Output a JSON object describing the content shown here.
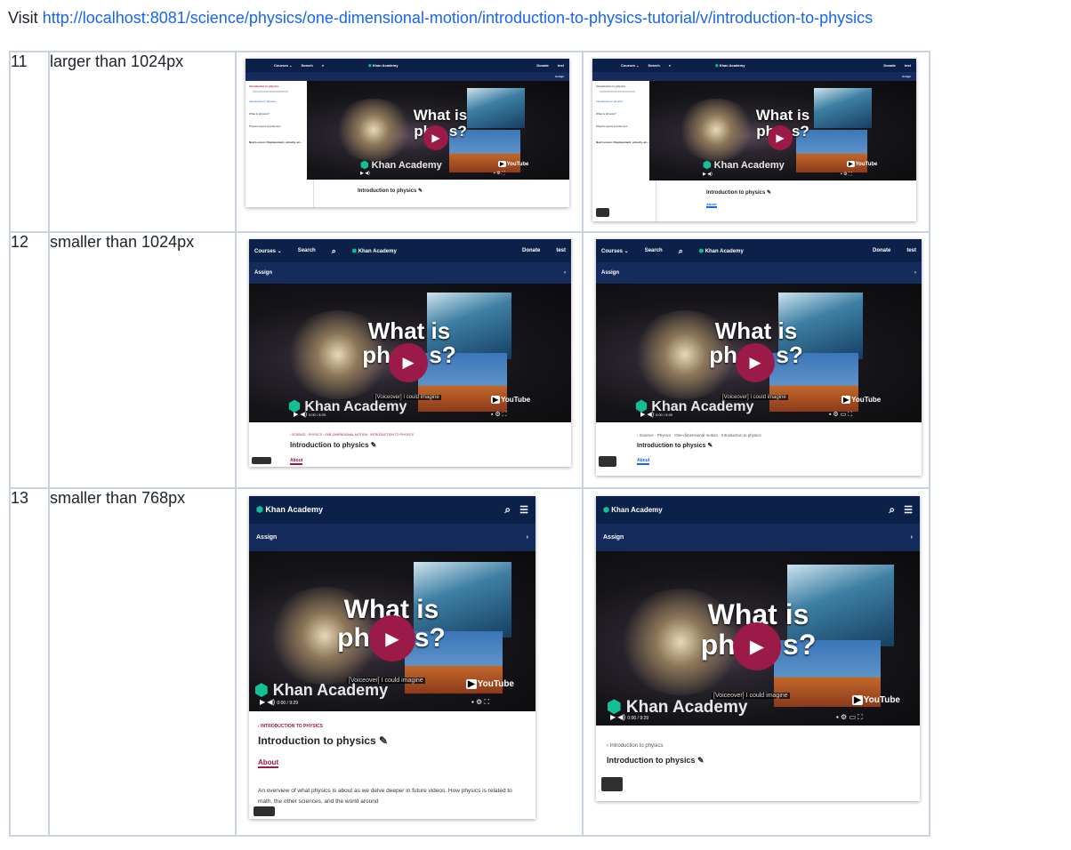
{
  "intro": {
    "prefix": "Visit ",
    "url": "http://localhost:8081/science/physics/one-dimensional-motion/introduction-to-physics-tutorial/v/introduction-to-physics"
  },
  "rows": [
    {
      "num": "11",
      "condition": "larger than 1024px"
    },
    {
      "num": "12",
      "condition": "smaller than 1024px"
    },
    {
      "num": "13",
      "condition": "smaller than 768px"
    }
  ],
  "thumb_text": {
    "courses": "Courses ⌄",
    "search": "Search",
    "brand": "Khan Academy",
    "donate": "Donate",
    "user": "test",
    "assign": "Assign",
    "video_title_line1": "What is",
    "video_title_line2a": "ph",
    "video_title_line2b": "s?",
    "ka_watermark": "Khan Academy",
    "youtube": "YouTube",
    "caption": "[Voiceover] I could imagine",
    "time": "0:00 / 9:29",
    "page_title": "Introduction to physics ✎",
    "crumb_upper": "‹ SCIENCE · PHYSICS · ONE-DIMENSIONAL MOTION · INTRODUCTION TO PHYSICS",
    "crumb_lower": "‹ Science · Physics · One-dimensional motion · Introduction to physics",
    "crumb_short_upper": "‹ INTRODUCTION TO PHYSICS",
    "crumb_short_lower": "‹ Introduction to physics",
    "about": "About",
    "about_text": "An overview of what physics is about as we delve deeper in future videos. How physics is related to math, the other sciences, and the world around",
    "side_title": "Introduction to physics",
    "side_items": [
      "Introduction to physics",
      "What is physics?",
      "Physics topics & study tips"
    ],
    "side_next": "Next Lesson: Displacement, velocity, an..."
  },
  "colors": {
    "nav": "#0b2149",
    "play": "#9c1a47",
    "link": "#1865f2",
    "table_border": "#c8d2e0"
  },
  "icons": [
    "search-icon",
    "hamburger-icon",
    "play-icon",
    "volume-icon",
    "settings-icon",
    "fullscreen-icon",
    "edit-icon"
  ]
}
